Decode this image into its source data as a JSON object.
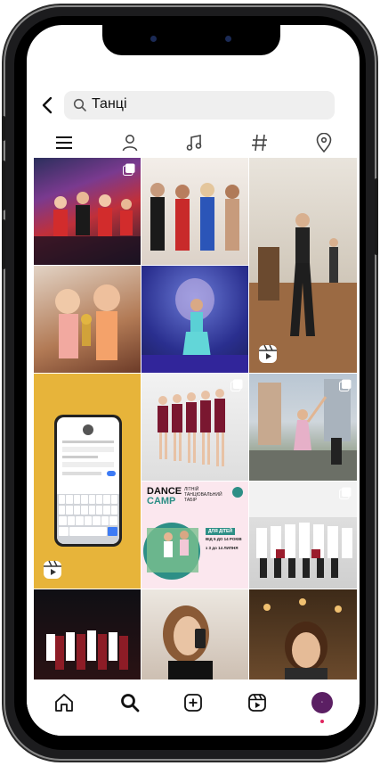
{
  "search": {
    "query": "Танці"
  },
  "tabs": [
    {
      "name": "accounts",
      "icon": "list-icon"
    },
    {
      "name": "profiles",
      "icon": "person-icon"
    },
    {
      "name": "audio",
      "icon": "music-note-icon"
    },
    {
      "name": "tags",
      "icon": "hashtag-icon"
    },
    {
      "name": "places",
      "icon": "location-pin-icon"
    }
  ],
  "posts": [
    {
      "kind": "carousel",
      "scene": "dance group in red"
    },
    {
      "kind": "image",
      "scene": "four women in colored bodysuits"
    },
    {
      "kind": "reel",
      "scene": "dancer in studio"
    },
    {
      "kind": "image",
      "scene": "girls with trophy"
    },
    {
      "kind": "image",
      "scene": "belly dancer on stage"
    },
    {
      "kind": "reel",
      "scene": "app screenshot on yellow"
    },
    {
      "kind": "carousel",
      "scene": "girls in burgundy dresses"
    },
    {
      "kind": "carousel",
      "scene": "gymnast outdoors"
    },
    {
      "kind": "image",
      "scene": "dance camp poster"
    },
    {
      "kind": "carousel",
      "scene": "group photo in hall"
    },
    {
      "kind": "image",
      "scene": "dancers on dark stage"
    },
    {
      "kind": "image",
      "scene": "mirror selfie"
    },
    {
      "kind": "image",
      "scene": "girl in restaurant"
    }
  ],
  "dance_camp": {
    "title_line1": "DANCE",
    "title_line2": "CAMP",
    "subtitle": "ЛІТНІЙ ТАНЦЮВАЛЬНИЙ ТАБІР",
    "tag": "ДЛЯ ДІТЕЙ",
    "age": "ВІД 5 ДО 14 РОКІВ",
    "dates": "з 3 до 14 ЛИПНЯ"
  },
  "colors": {
    "accent_pink": "#e0245e",
    "mustard": "#e7b43a",
    "avatar": "#5b1f63",
    "search_bg": "#efefef"
  },
  "nav": [
    {
      "name": "home",
      "icon": "home-icon"
    },
    {
      "name": "search",
      "icon": "search-icon",
      "active": true
    },
    {
      "name": "create",
      "icon": "plus-square-icon"
    },
    {
      "name": "reels",
      "icon": "reels-icon"
    },
    {
      "name": "profile",
      "icon": "avatar"
    }
  ]
}
